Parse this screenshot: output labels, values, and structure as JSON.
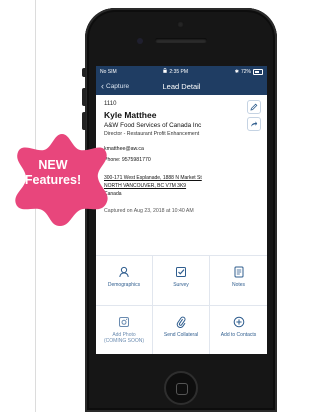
{
  "status_bar": {
    "carrier": "No SIM",
    "time": "2:35 PM",
    "battery": "72%"
  },
  "nav": {
    "back_label": "Capture",
    "title": "Lead Detail"
  },
  "lead": {
    "id": "1110",
    "name": "Kyle Matthee",
    "company": "A&W Food Services of Canada Inc",
    "title": "Director - Restaurant Profit Enhancement",
    "email": "kmatthee@aw.ca",
    "phone": "Phone: 9575981770",
    "address_line1": "300-171 West Esplanade, 1888 N Market St",
    "address_line2": "NORTH VANCOUVER, BC V7M 3K9",
    "country": "Canada",
    "captured": "Captured on Aug 23, 2018 at 10:40 AM"
  },
  "actions": [
    {
      "label": "Demographics",
      "icon": "person-search-icon"
    },
    {
      "label": "Survey",
      "icon": "survey-check-icon"
    },
    {
      "label": "Notes",
      "icon": "notes-icon"
    },
    {
      "label": "Add Photo\n(COMING SOON)",
      "icon": "camera-icon"
    },
    {
      "label": "Send Collateral",
      "icon": "paperclip-icon"
    },
    {
      "label": "Add to Contacts",
      "icon": "plus-circle-icon"
    }
  ],
  "promo": {
    "line1": "NEW",
    "line2": "Features!",
    "color": "#e8467c"
  },
  "colors": {
    "nav": "#1f3d63",
    "accent": "#2f5d8e"
  }
}
